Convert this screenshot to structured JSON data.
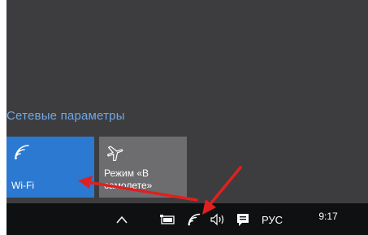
{
  "flyout": {
    "network_settings_link": "Сетевые параметры",
    "tiles": [
      {
        "label": "Wi-Fi",
        "icon": "wifi-icon",
        "state": "on",
        "color": "#2b79d1"
      },
      {
        "label": "Режим «В самолете»",
        "icon": "airplane-icon",
        "state": "off",
        "color": "#6d6d70"
      }
    ]
  },
  "taskbar": {
    "icons": [
      "chevron-up-icon",
      "battery-icon",
      "wifi-icon",
      "volume-icon",
      "action-center-icon"
    ],
    "language": "РУС",
    "time": "9:17"
  },
  "annotations": {
    "arrow_color": "#e02020"
  }
}
